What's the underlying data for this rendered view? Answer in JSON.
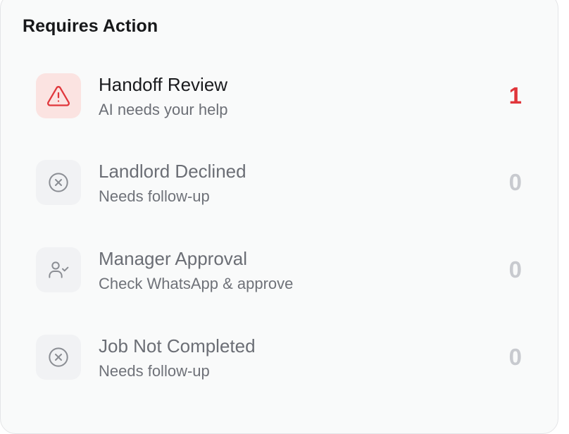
{
  "panel": {
    "title": "Requires Action"
  },
  "items": [
    {
      "title": "Handoff Review",
      "subtitle": "AI needs your help",
      "count": "1",
      "icon": "warning-triangle-icon",
      "accent": "#e0363b",
      "icon_bg": "#fbe3e1"
    },
    {
      "title": "Landlord Declined",
      "subtitle": "Needs follow-up",
      "count": "0",
      "icon": "x-circle-icon"
    },
    {
      "title": "Manager Approval",
      "subtitle": "Check WhatsApp & approve",
      "count": "0",
      "icon": "user-check-icon"
    },
    {
      "title": "Job Not Completed",
      "subtitle": "Needs follow-up",
      "count": "0",
      "icon": "x-circle-icon"
    }
  ]
}
